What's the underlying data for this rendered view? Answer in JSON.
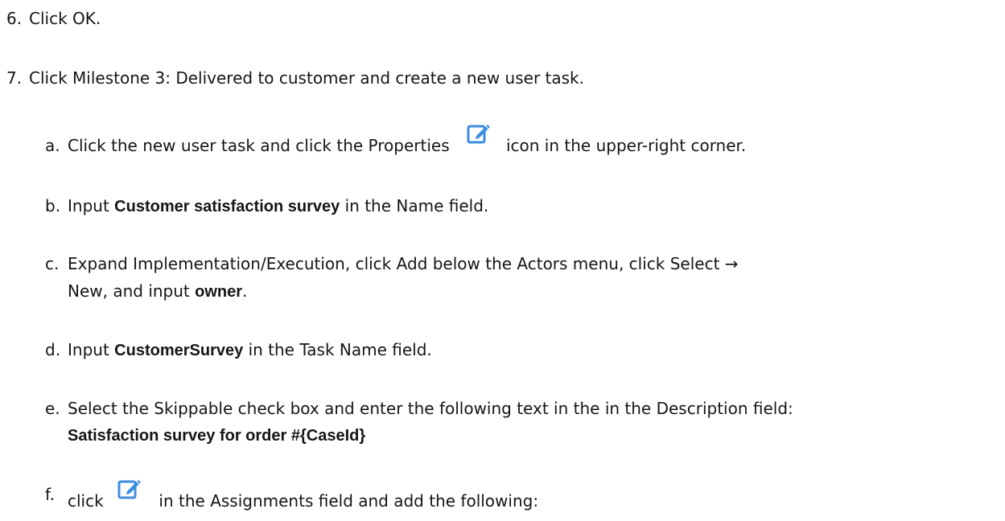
{
  "steps": {
    "s6": {
      "marker": "6.",
      "t1": "Click ",
      "b1": "OK",
      "t2": "."
    },
    "s7": {
      "marker": "7.",
      "t1": "Click ",
      "b1": "Milestone 3: Delivered to customer",
      "t2": " and create a new user task."
    },
    "a": {
      "marker": "a.",
      "t1": "Click the new user task and click the ",
      "b1": "Properties",
      "icon": "edit-properties-icon",
      "t2": " icon in the upper-right corner."
    },
    "b": {
      "marker": "b.",
      "t1": "Input ",
      "c1": "Customer satisfaction survey",
      "t2": " in the ",
      "b1": "Name",
      "t3": " field."
    },
    "c": {
      "marker": "c.",
      "t1": "Expand ",
      "b1": "Implementation/Execution",
      "t2": ", click ",
      "b2": "Add",
      "t3": " below the ",
      "b3": "Actors",
      "t4": " menu, click ",
      "b4": "Select",
      "t5": " → ",
      "b5": "New",
      "t6": ", and input ",
      "c1": "owner",
      "t7": "."
    },
    "d": {
      "marker": "d.",
      "t1": "Input ",
      "c1": "CustomerSurvey",
      "t2": " in the ",
      "b1": "Task Name",
      "t3": " field."
    },
    "e": {
      "marker": "e.",
      "t1": "Select the ",
      "b1": "Skippable",
      "t2": " check box and enter the following text in the in the ",
      "b2": "Description",
      "t3": " field:",
      "c1": "Satisfaction survey for order #{CaseId}"
    },
    "f": {
      "marker": "f.",
      "t1": "click ",
      "icon": "edit-assignments-icon",
      "t2": " in the ",
      "b1": "Assignments",
      "t3": " field and add the following:"
    }
  },
  "icon_color": "#3c8de0"
}
